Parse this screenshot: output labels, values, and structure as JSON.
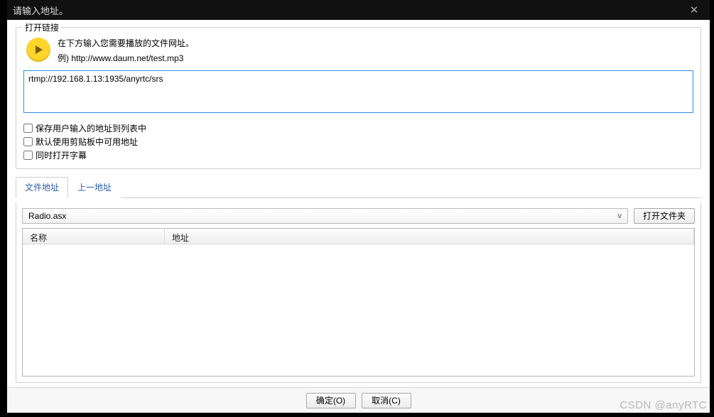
{
  "titlebar": {
    "title": "请输入地址。"
  },
  "group": {
    "legend": "打开链接",
    "instruction": "在下方输入您需要播放的文件网址。",
    "example": "例) http://www.daum.net/test.mp3",
    "url_value": "rtmp://192.168.1.13:1935/anyrtc/srs"
  },
  "checks": {
    "save_to_list": "保存用户输入的地址到列表中",
    "use_clipboard": "默认使用剪贴板中可用地址",
    "open_subtitle": "同时打开字幕"
  },
  "tabs": {
    "file_addr": "文件地址",
    "prev_addr": "上一地址"
  },
  "path": {
    "selected": "Radio.asx",
    "open_folder": "打开文件夹"
  },
  "list": {
    "col_name": "名称",
    "col_addr": "地址"
  },
  "footer": {
    "ok": "确定(O)",
    "cancel": "取消(C)"
  },
  "watermark": "CSDN @anyRTC"
}
